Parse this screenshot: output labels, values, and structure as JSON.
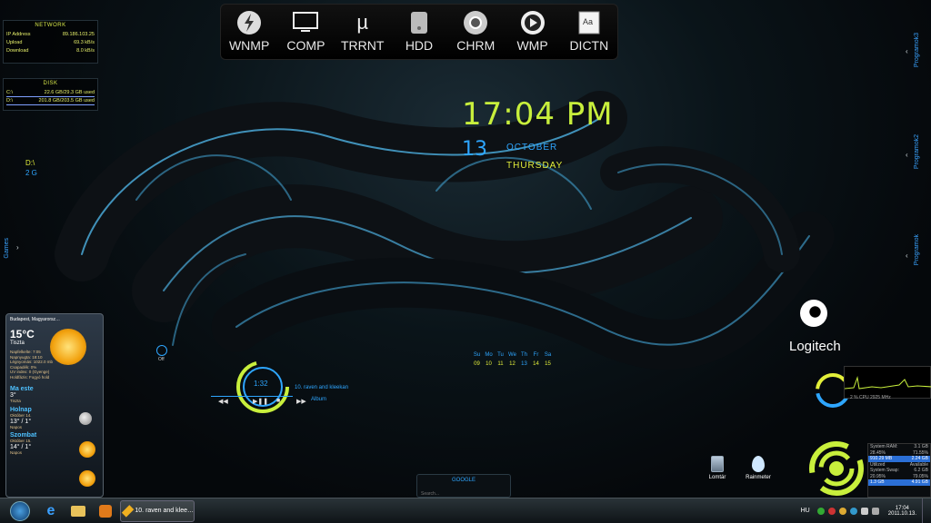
{
  "dock": [
    {
      "label": "WNMP",
      "icon": "lightning-icon"
    },
    {
      "label": "COMP",
      "icon": "monitor-icon"
    },
    {
      "label": "TRRNT",
      "icon": "utorrent-icon"
    },
    {
      "label": "HDD",
      "icon": "hard-drive-icon"
    },
    {
      "label": "CHRM",
      "icon": "chrome-icon"
    },
    {
      "label": "WMP",
      "icon": "media-player-icon"
    },
    {
      "label": "DICTN",
      "icon": "dictionary-icon"
    }
  ],
  "network": {
    "title": "NETWORK",
    "rows": [
      {
        "k": "IP Address",
        "v": "89.186.103.25"
      },
      {
        "k": "Upload",
        "v": "69.3 kB/s"
      },
      {
        "k": "Download",
        "v": "8.0 kB/s"
      }
    ]
  },
  "disk": {
    "title": "DISK",
    "rows": [
      {
        "k": "C:\\",
        "v": "22.6 GB/29.3 GB used"
      },
      {
        "k": "D:\\",
        "v": "201.8 GB/203.5 GB used"
      }
    ]
  },
  "drive": {
    "name": "D:\\",
    "size": "2 G"
  },
  "clock": {
    "time": "17:04 PM",
    "day": "13",
    "month": "OCTOBER",
    "weekday": "THURSDAY"
  },
  "side_tabs": {
    "right1": "Programok3",
    "right2": "Programok2",
    "right3": "Programok",
    "left": "Games"
  },
  "off_label": "Off",
  "weather": {
    "location": "Budapest, Magyarorsz…",
    "temp": "15°C",
    "cond": "Tiszta",
    "details": [
      "Napfelkelte: 7:05",
      "Napnyugta: 18:10",
      "Légnyomás: 1022.0 mb",
      "Csapadék: 0%",
      "UV index: 0 (Gyenge)",
      "Holdfázis: Fogyó hold"
    ],
    "tonight": "Ma este",
    "tonight_temp": "3°",
    "tonight_cond": "Tiszta",
    "tomorrow": "Holnap",
    "tomorrow_date": "Október 14.",
    "tomorrow_temp": "13° / 1°",
    "tomorrow_cond": "Napos",
    "sat": "Szombat",
    "sat_date": "Október 15.",
    "sat_temp": "14° / 1°",
    "sat_cond": "Napos"
  },
  "calendar": {
    "days": [
      "Su",
      "Mo",
      "Tu",
      "We",
      "Th",
      "Fr",
      "Sa"
    ],
    "dates": [
      "09",
      "10",
      "11",
      "12",
      "13",
      "14",
      "15"
    ]
  },
  "player": {
    "time": "1:32",
    "track": "10. raven and kleekan",
    "album": "Album"
  },
  "google": {
    "title": "GOOGLE",
    "placeholder": "Search..."
  },
  "logitech": "Logitech",
  "desktop_icons": [
    {
      "label": "Lomtár",
      "icon": "recycle-bin-icon"
    },
    {
      "label": "Rainmeter",
      "icon": "rainmeter-icon"
    }
  ],
  "cpu": "2 %  CPU 2925 MHz",
  "mem": {
    "rows": [
      {
        "a": "System RAM:",
        "b": "3.1 GB",
        "hl": false
      },
      {
        "a": "28.45%",
        "b": "71.55%",
        "hl": false
      },
      {
        "a": "910.29 MB",
        "b": "2.24 GB",
        "hl": true
      },
      {
        "a": "Utilized",
        "b": "Available",
        "hl": false
      },
      {
        "a": "System Swap:",
        "b": "6.2 GB",
        "hl": false
      },
      {
        "a": "20.95%",
        "b": "79.05%",
        "hl": false
      },
      {
        "a": "1.3 GB",
        "b": "4.91 GB",
        "hl": true
      }
    ]
  },
  "taskbar": {
    "task": "10. raven and klee…",
    "lang": "HU",
    "time": "17:04",
    "date": "2011.10.13."
  },
  "colors": {
    "lime": "#c8ef3c",
    "blue": "#2ea6ff",
    "yellow": "#e3ef3a"
  }
}
